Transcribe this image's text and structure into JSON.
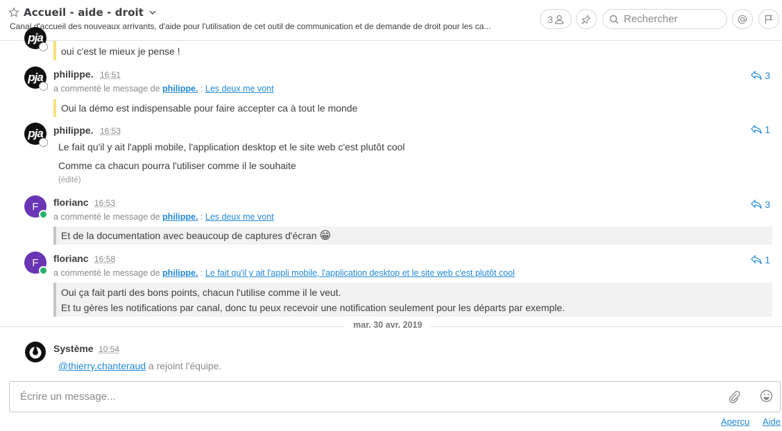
{
  "header": {
    "channel_name": "Accueil - aide - droit",
    "purpose": "Canal d'accueil des nouveaux arrivants, d'aide pour l'utilisation de cet outil de communication et de demande de droit pour les ca...",
    "member_count": "3",
    "search_placeholder": "Rechercher"
  },
  "first_post": {
    "quote": "oui c'est le mieux je pense !"
  },
  "posts": [
    {
      "username": "philippe.",
      "time": "16:51",
      "commented_prefix": "a commenté le message de",
      "commented_user": "philippe.",
      "commented_sep": ":",
      "commented_link": "Les deux me vont",
      "text": "Oui la démo est indispensable pour faire accepter ca à tout le monde",
      "reply_count": "3"
    },
    {
      "username": "philippe.",
      "time": "16:53",
      "line1": "Le fait qu'il y ait l'appli mobile, l'application desktop et le site web c'est plutôt cool",
      "line2": "Comme ca chacun pourra l'utiliser comme il le souhaite",
      "edited": "(édité)",
      "reply_count": "1"
    },
    {
      "username": "florianc",
      "time": "16:53",
      "commented_prefix": "a commenté le message de",
      "commented_user": "philippe.",
      "commented_sep": ":",
      "commented_link": "Les deux me vont",
      "text": "Et de la documentation avec beaucoup de captures d'écran",
      "emoji": "😁",
      "reply_count": "3"
    },
    {
      "username": "florianc",
      "time": "16:58",
      "commented_prefix": "a commenté le message de",
      "commented_user": "philippe.",
      "commented_sep": ":",
      "commented_link": "Le fait qu'il y ait l'appli mobile, l'application desktop et le site web c'est plutôt cool",
      "line1": "Oui ça fait parti des bons points, chacun l'utilise comme il le veut.",
      "line2": "Et tu gères les notifications par canal, donc tu peux recevoir une notification seulement pour les départs par exemple.",
      "reply_count": "1"
    }
  ],
  "date_separator": "mar. 30 avr. 2019",
  "system_post": {
    "username": "Système",
    "time": "10:54",
    "mention": "@thierry.chanteraud",
    "text_a": " a ",
    "text_b": "rejoint l'équipe."
  },
  "composer": {
    "placeholder": "Écrire un message..."
  },
  "footer": {
    "preview": "Aperçu",
    "help": "Aide"
  },
  "avatars": {
    "philippe_label": "pja",
    "florianc_label": "F"
  },
  "colors": {
    "link": "#2389d7",
    "online": "#21b36e",
    "avatar_f": "#6a35b5"
  }
}
